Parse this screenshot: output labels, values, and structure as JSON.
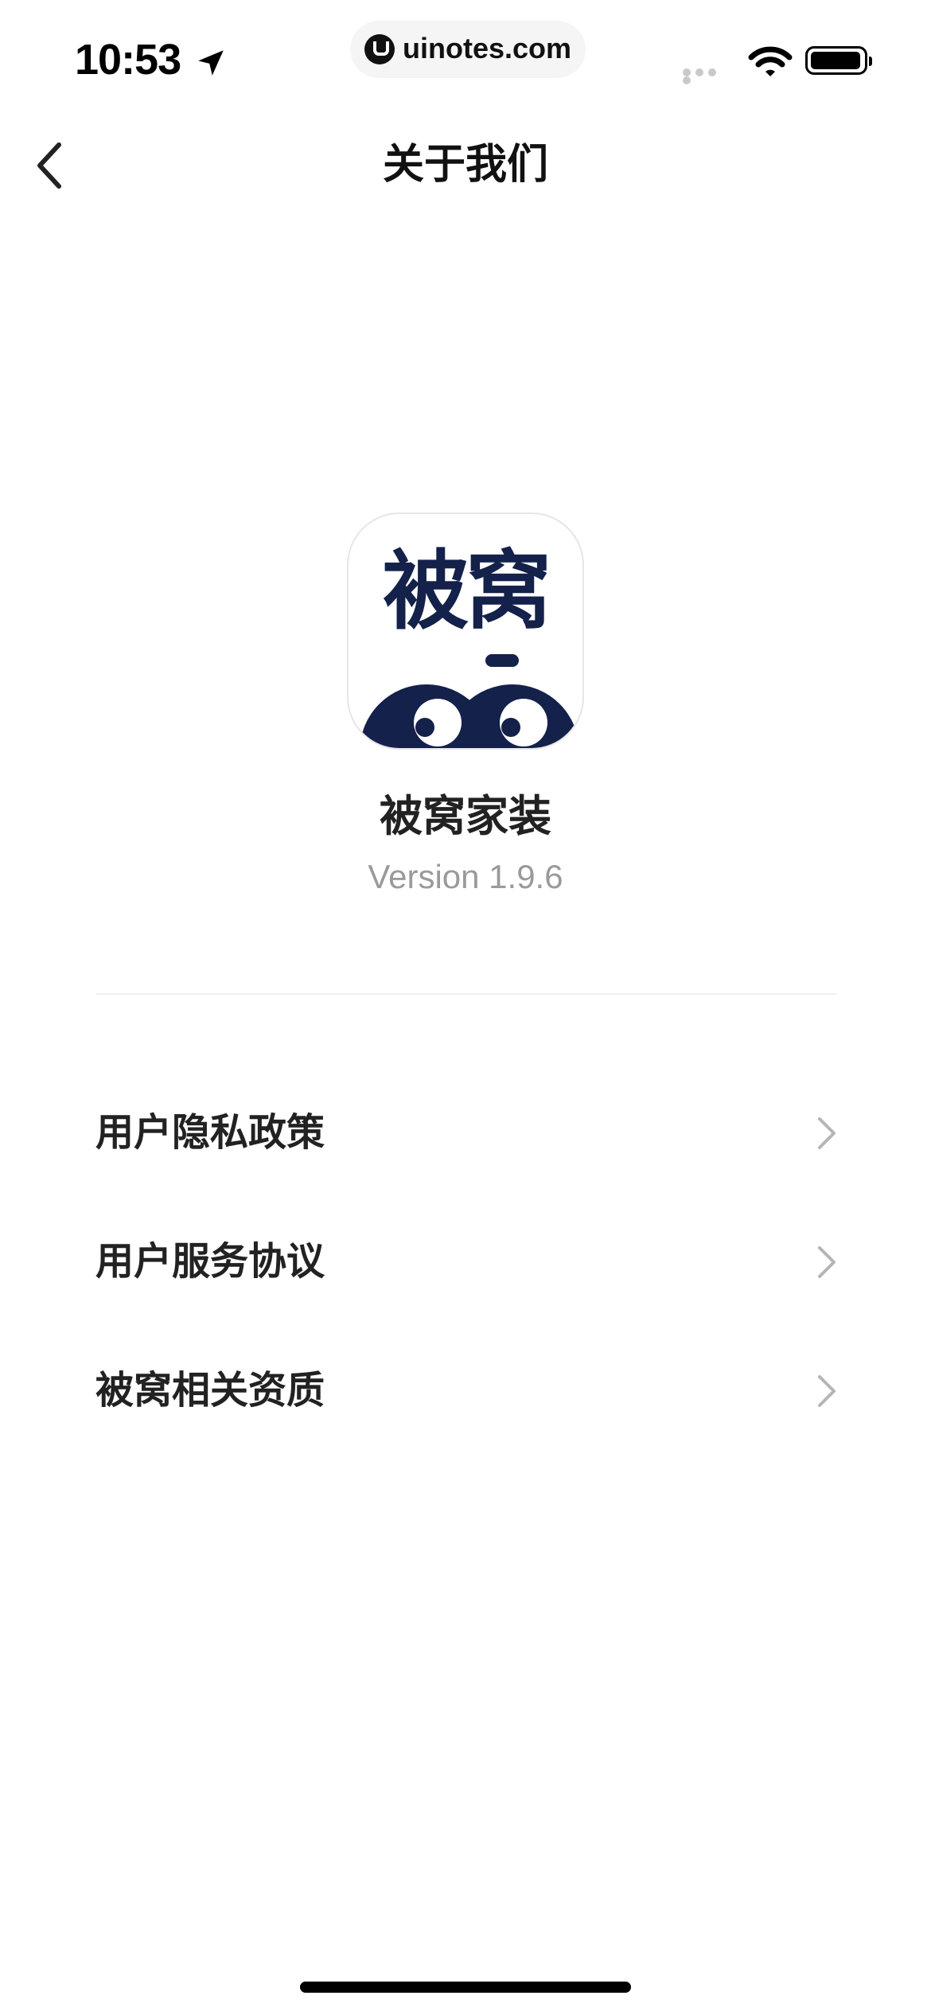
{
  "status_bar": {
    "time": "10:53",
    "url": "uinotes.com"
  },
  "nav": {
    "title": "关于我们"
  },
  "app": {
    "icon_text": "被窝",
    "name": "被窝家装",
    "version": "Version 1.9.6",
    "brand_color": "#14214a"
  },
  "menu": {
    "items": [
      {
        "label": "用户隐私政策"
      },
      {
        "label": "用户服务协议"
      },
      {
        "label": "被窝相关资质"
      }
    ]
  }
}
